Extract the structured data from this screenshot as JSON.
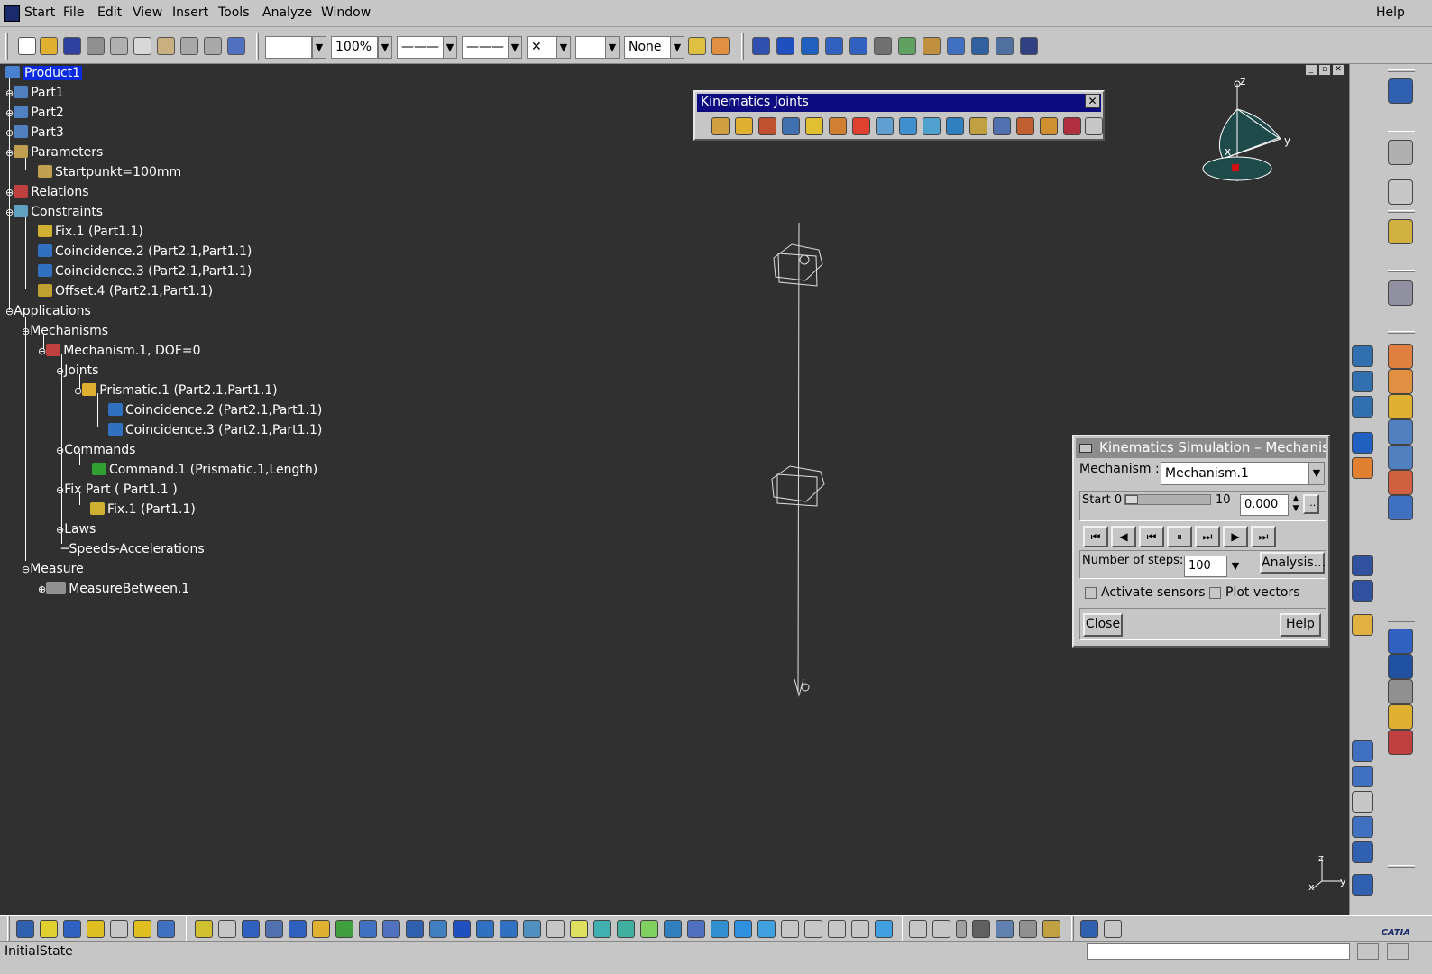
{
  "menubar": {
    "items": [
      "Start",
      "File",
      "Edit",
      "View",
      "Insert",
      "Tools",
      "Analyze",
      "Window"
    ],
    "help": "Help"
  },
  "toolbar": {
    "zoom": "100%",
    "none": "None"
  },
  "tree": {
    "nodes": [
      "Product1",
      "Part1",
      "Part2",
      "Part3",
      "Parameters",
      "Startpunkt=100mm",
      "Relations",
      "Constraints",
      "Fix.1 (Part1.1)",
      "Coincidence.2 (Part2.1,Part1.1)",
      "Coincidence.3 (Part2.1,Part1.1)",
      "Offset.4 (Part2.1,Part1.1)",
      "Applications",
      "Mechanisms",
      "Mechanism.1, DOF=0",
      "Joints",
      "Prismatic.1 (Part2.1,Part1.1)",
      "Coincidence.2 (Part2.1,Part1.1)",
      "Coincidence.3 (Part2.1,Part1.1)",
      "Commands",
      "Command.1 (Prismatic.1,Length)",
      "Fix Part ( Part1.1 )",
      "Fix.1 (Part1.1)",
      "Laws",
      "Speeds-Accelerations",
      "Measure",
      "MeasureBetween.1"
    ]
  },
  "kinematics_joints": {
    "title": "Kinematics Joints",
    "close": "✕"
  },
  "compass": {
    "z": "z",
    "y": "y",
    "x": "x"
  },
  "axis_small": {
    "z": "z",
    "x": "x",
    "y": "y"
  },
  "simulation": {
    "title": "Kinematics Simulation – Mechanism",
    "mechanism_label": "Mechanism :",
    "mechanism_value": "Mechanism.1",
    "start_label": "Start 0",
    "end_label": "10",
    "value": "0.000",
    "more": "...",
    "steps_label": "Number of steps:",
    "steps_value": "100",
    "analysis": "Analysis...",
    "activate_sensors": "Activate sensors",
    "plot_vectors": "Plot vectors",
    "close": "Close",
    "help": "Help",
    "slider_fraction": 0
  },
  "bottom": {
    "catia": "CATIA"
  },
  "status": {
    "text": "InitialState"
  }
}
